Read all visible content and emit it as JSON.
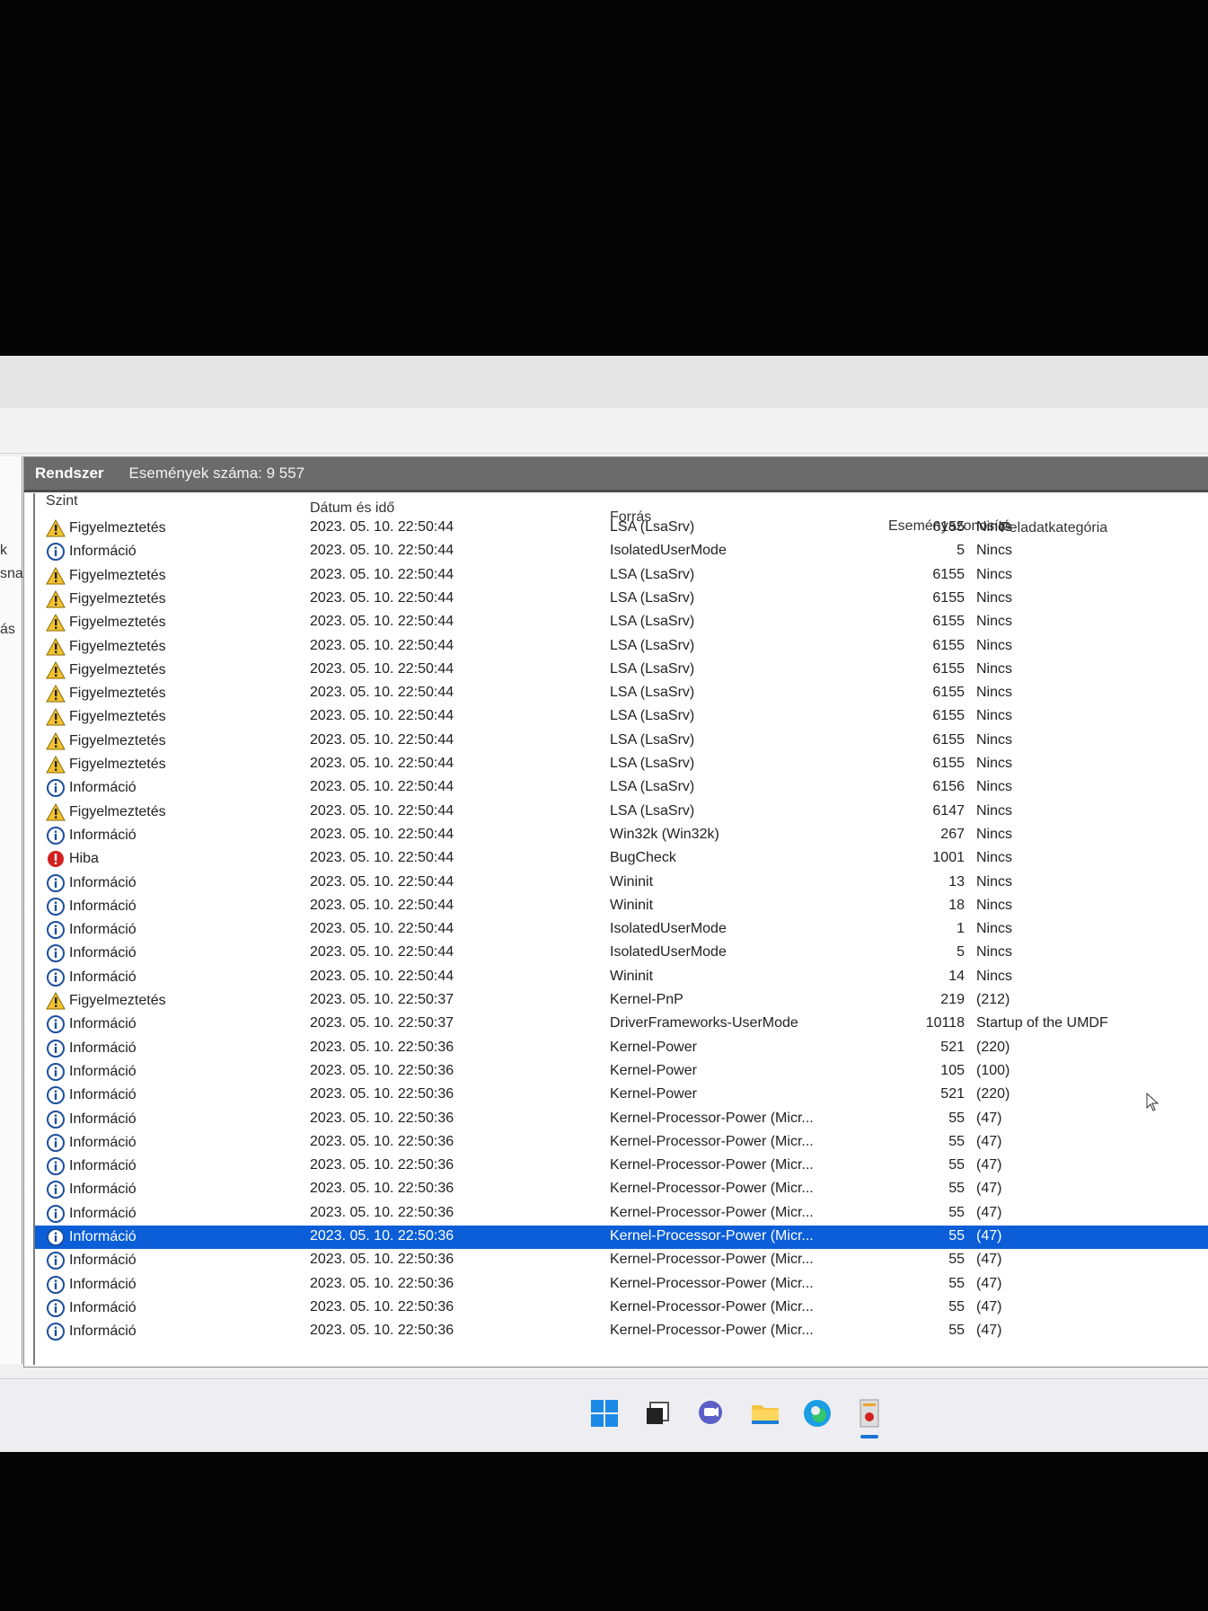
{
  "panel": {
    "title": "Rendszer",
    "event_count": "Események száma: 9 557"
  },
  "left_fragments": [
    "k",
    "sna",
    "ás"
  ],
  "columns": {
    "level": "Szint",
    "datetime": "Dátum és idő",
    "source": "Forrás",
    "event_id": "Eseményazonosító",
    "category": "Feladatkategória"
  },
  "rows": [
    {
      "icon": "warning",
      "level": "Figyelmeztetés",
      "datetime": "2023. 05. 10. 22:50:44",
      "source": "LSA (LsaSrv)",
      "event_id": "6155",
      "category": "Nincs"
    },
    {
      "icon": "info",
      "level": "Információ",
      "datetime": "2023. 05. 10. 22:50:44",
      "source": "IsolatedUserMode",
      "event_id": "5",
      "category": "Nincs"
    },
    {
      "icon": "warning",
      "level": "Figyelmeztetés",
      "datetime": "2023. 05. 10. 22:50:44",
      "source": "LSA (LsaSrv)",
      "event_id": "6155",
      "category": "Nincs"
    },
    {
      "icon": "warning",
      "level": "Figyelmeztetés",
      "datetime": "2023. 05. 10. 22:50:44",
      "source": "LSA (LsaSrv)",
      "event_id": "6155",
      "category": "Nincs"
    },
    {
      "icon": "warning",
      "level": "Figyelmeztetés",
      "datetime": "2023. 05. 10. 22:50:44",
      "source": "LSA (LsaSrv)",
      "event_id": "6155",
      "category": "Nincs"
    },
    {
      "icon": "warning",
      "level": "Figyelmeztetés",
      "datetime": "2023. 05. 10. 22:50:44",
      "source": "LSA (LsaSrv)",
      "event_id": "6155",
      "category": "Nincs"
    },
    {
      "icon": "warning",
      "level": "Figyelmeztetés",
      "datetime": "2023. 05. 10. 22:50:44",
      "source": "LSA (LsaSrv)",
      "event_id": "6155",
      "category": "Nincs"
    },
    {
      "icon": "warning",
      "level": "Figyelmeztetés",
      "datetime": "2023. 05. 10. 22:50:44",
      "source": "LSA (LsaSrv)",
      "event_id": "6155",
      "category": "Nincs"
    },
    {
      "icon": "warning",
      "level": "Figyelmeztetés",
      "datetime": "2023. 05. 10. 22:50:44",
      "source": "LSA (LsaSrv)",
      "event_id": "6155",
      "category": "Nincs"
    },
    {
      "icon": "warning",
      "level": "Figyelmeztetés",
      "datetime": "2023. 05. 10. 22:50:44",
      "source": "LSA (LsaSrv)",
      "event_id": "6155",
      "category": "Nincs"
    },
    {
      "icon": "warning",
      "level": "Figyelmeztetés",
      "datetime": "2023. 05. 10. 22:50:44",
      "source": "LSA (LsaSrv)",
      "event_id": "6155",
      "category": "Nincs"
    },
    {
      "icon": "info",
      "level": "Információ",
      "datetime": "2023. 05. 10. 22:50:44",
      "source": "LSA (LsaSrv)",
      "event_id": "6156",
      "category": "Nincs"
    },
    {
      "icon": "warning",
      "level": "Figyelmeztetés",
      "datetime": "2023. 05. 10. 22:50:44",
      "source": "LSA (LsaSrv)",
      "event_id": "6147",
      "category": "Nincs"
    },
    {
      "icon": "info",
      "level": "Információ",
      "datetime": "2023. 05. 10. 22:50:44",
      "source": "Win32k (Win32k)",
      "event_id": "267",
      "category": "Nincs"
    },
    {
      "icon": "error",
      "level": "Hiba",
      "datetime": "2023. 05. 10. 22:50:44",
      "source": "BugCheck",
      "event_id": "1001",
      "category": "Nincs"
    },
    {
      "icon": "info",
      "level": "Információ",
      "datetime": "2023. 05. 10. 22:50:44",
      "source": "Wininit",
      "event_id": "13",
      "category": "Nincs"
    },
    {
      "icon": "info",
      "level": "Információ",
      "datetime": "2023. 05. 10. 22:50:44",
      "source": "Wininit",
      "event_id": "18",
      "category": "Nincs"
    },
    {
      "icon": "info",
      "level": "Információ",
      "datetime": "2023. 05. 10. 22:50:44",
      "source": "IsolatedUserMode",
      "event_id": "1",
      "category": "Nincs"
    },
    {
      "icon": "info",
      "level": "Információ",
      "datetime": "2023. 05. 10. 22:50:44",
      "source": "IsolatedUserMode",
      "event_id": "5",
      "category": "Nincs"
    },
    {
      "icon": "info",
      "level": "Információ",
      "datetime": "2023. 05. 10. 22:50:44",
      "source": "Wininit",
      "event_id": "14",
      "category": "Nincs"
    },
    {
      "icon": "warning",
      "level": "Figyelmeztetés",
      "datetime": "2023. 05. 10. 22:50:37",
      "source": "Kernel-PnP",
      "event_id": "219",
      "category": "(212)"
    },
    {
      "icon": "info",
      "level": "Információ",
      "datetime": "2023. 05. 10. 22:50:37",
      "source": "DriverFrameworks-UserMode",
      "event_id": "10118",
      "category": "Startup of the UMDF"
    },
    {
      "icon": "info",
      "level": "Információ",
      "datetime": "2023. 05. 10. 22:50:36",
      "source": "Kernel-Power",
      "event_id": "521",
      "category": "(220)"
    },
    {
      "icon": "info",
      "level": "Információ",
      "datetime": "2023. 05. 10. 22:50:36",
      "source": "Kernel-Power",
      "event_id": "105",
      "category": "(100)"
    },
    {
      "icon": "info",
      "level": "Információ",
      "datetime": "2023. 05. 10. 22:50:36",
      "source": "Kernel-Power",
      "event_id": "521",
      "category": "(220)"
    },
    {
      "icon": "info",
      "level": "Információ",
      "datetime": "2023. 05. 10. 22:50:36",
      "source": "Kernel-Processor-Power (Micr...",
      "event_id": "55",
      "category": "(47)"
    },
    {
      "icon": "info",
      "level": "Információ",
      "datetime": "2023. 05. 10. 22:50:36",
      "source": "Kernel-Processor-Power (Micr...",
      "event_id": "55",
      "category": "(47)"
    },
    {
      "icon": "info",
      "level": "Információ",
      "datetime": "2023. 05. 10. 22:50:36",
      "source": "Kernel-Processor-Power (Micr...",
      "event_id": "55",
      "category": "(47)"
    },
    {
      "icon": "info",
      "level": "Információ",
      "datetime": "2023. 05. 10. 22:50:36",
      "source": "Kernel-Processor-Power (Micr...",
      "event_id": "55",
      "category": "(47)"
    },
    {
      "icon": "info",
      "level": "Információ",
      "datetime": "2023. 05. 10. 22:50:36",
      "source": "Kernel-Processor-Power (Micr...",
      "event_id": "55",
      "category": "(47)"
    },
    {
      "icon": "info",
      "level": "Információ",
      "datetime": "2023. 05. 10. 22:50:36",
      "source": "Kernel-Processor-Power (Micr...",
      "event_id": "55",
      "category": "(47)",
      "selected": true
    },
    {
      "icon": "info",
      "level": "Információ",
      "datetime": "2023. 05. 10. 22:50:36",
      "source": "Kernel-Processor-Power (Micr...",
      "event_id": "55",
      "category": "(47)"
    },
    {
      "icon": "info",
      "level": "Információ",
      "datetime": "2023. 05. 10. 22:50:36",
      "source": "Kernel-Processor-Power (Micr...",
      "event_id": "55",
      "category": "(47)"
    },
    {
      "icon": "info",
      "level": "Információ",
      "datetime": "2023. 05. 10. 22:50:36",
      "source": "Kernel-Processor-Power (Micr...",
      "event_id": "55",
      "category": "(47)"
    },
    {
      "icon": "info",
      "level": "Információ",
      "datetime": "2023. 05. 10. 22:50:36",
      "source": "Kernel-Processor-Power (Micr...",
      "event_id": "55",
      "category": "(47)"
    }
  ],
  "taskbar": {
    "items": [
      "start-icon",
      "task-view-icon",
      "chat-icon",
      "file-explorer-icon",
      "edge-icon",
      "event-viewer-icon"
    ],
    "active": "event-viewer-icon"
  },
  "colors": {
    "selection": "#0b5ed7",
    "header": "#6b6b6b",
    "warning": "#f2c230",
    "info": "#1d4f9c",
    "error": "#d32020"
  }
}
